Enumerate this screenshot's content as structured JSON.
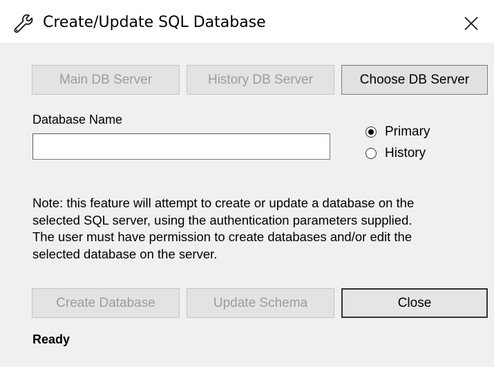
{
  "window": {
    "title": "Create/Update SQL Database",
    "title_icon": "wrench-icon",
    "close_icon": "close-icon"
  },
  "server_buttons": {
    "main": "Main DB Server",
    "history": "History DB Server",
    "choose": "Choose DB Server"
  },
  "database_name": {
    "label": "Database Name",
    "value": "",
    "placeholder": ""
  },
  "target": {
    "options": [
      {
        "label": "Primary",
        "selected": true
      },
      {
        "label": "History",
        "selected": false
      }
    ]
  },
  "note": "Note: this feature will attempt to create or update a database on the\nselected SQL server, using the authentication parameters supplied.\nThe user must have permission to create databases and/or edit the\nselected database on the server.",
  "actions": {
    "create": "Create Database",
    "update": "Update Schema",
    "close": "Close"
  },
  "status": "Ready"
}
